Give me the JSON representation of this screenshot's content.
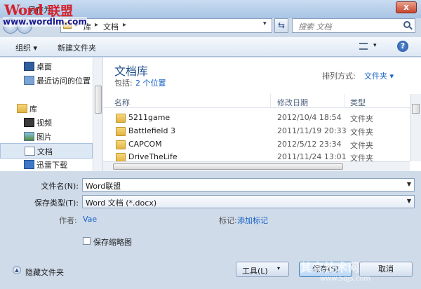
{
  "brand": {
    "logo_word": "Word",
    "logo_cn": "联盟",
    "url": "www.wordlm.com"
  },
  "window": {
    "title": "另存为",
    "close": "x"
  },
  "address": {
    "sep": "▸",
    "crumbs": [
      "库",
      "文档"
    ],
    "dropdown": "▾"
  },
  "search": {
    "placeholder": "搜索 文档"
  },
  "toolbar": {
    "organize": "组织 ▾",
    "new_folder": "新建文件夹",
    "view_dd": "▾",
    "help": "?"
  },
  "nav": {
    "items": [
      {
        "label": "桌面",
        "icon": "desktop-icon"
      },
      {
        "label": "最近访问的位置",
        "icon": "recent-places-icon"
      },
      {
        "label": "库",
        "icon": "library-icon"
      },
      {
        "label": "视频",
        "icon": "videos-icon"
      },
      {
        "label": "图片",
        "icon": "pictures-icon"
      },
      {
        "label": "文档",
        "icon": "documents-icon"
      },
      {
        "label": "迅雷下载",
        "icon": "thunder-download-icon"
      }
    ]
  },
  "library": {
    "title": "文档库",
    "includes_label": "包括:",
    "includes_link": "2 个位置",
    "arrange_label": "排列方式:",
    "arrange_value": "文件夹 ▾"
  },
  "columns": {
    "name": "名称",
    "date": "修改日期",
    "type": "类型"
  },
  "files": [
    {
      "name": "5211game",
      "date": "2012/10/4 18:54",
      "type": "文件夹"
    },
    {
      "name": "Battlefield 3",
      "date": "2011/11/19 20:33",
      "type": "文件夹"
    },
    {
      "name": "CAPCOM",
      "date": "2012/5/12 23:34",
      "type": "文件夹"
    },
    {
      "name": "DriveTheLife",
      "date": "2011/11/24 13:01",
      "type": "文件夹"
    }
  ],
  "form": {
    "filename_label": "文件名(N):",
    "filename_value": "Word联盟",
    "filetype_label": "保存类型(T):",
    "filetype_value": "Word 文档 (*.docx)",
    "author_label": "作者:",
    "author_value": "Vae",
    "tags_label": "标记:",
    "tags_value": "添加标记",
    "thumb_label": "保存缩略图"
  },
  "bottom": {
    "hide_folders": "隐藏文件夹",
    "tools": "工具(L)",
    "tools_dd": "▾",
    "save": "保存(S)",
    "cancel": "取消"
  },
  "watermark": {
    "line1": "其实技术网",
    "line2": "www.5qjs.com"
  }
}
